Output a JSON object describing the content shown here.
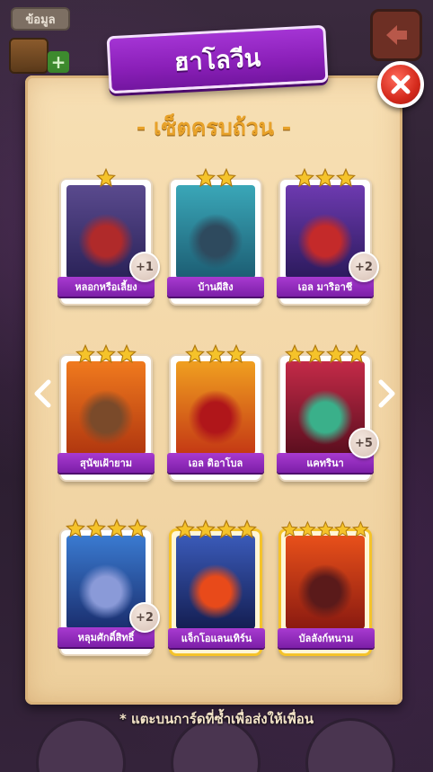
{
  "background": {
    "info_button": "ข้อมูล",
    "plus": "+"
  },
  "header": {
    "title": "ฮาโลวีน",
    "subtitle": "- เซ็ตครบถ้วน -"
  },
  "colors": {
    "ribbon": "#8a1fb8",
    "subtitle": "#e8a22a",
    "close": "#d42a1c",
    "star": "#f5c32a",
    "label": "#7c1fa8"
  },
  "cards": [
    {
      "name": "หลอกหรือเลี้ยง",
      "stars": 1,
      "badge": "+1",
      "gold": false,
      "art": "vampire"
    },
    {
      "name": "บ้านผีสิง",
      "stars": 2,
      "badge": "",
      "gold": false,
      "art": "haunted-house"
    },
    {
      "name": "เอล มาริอาชี",
      "stars": 3,
      "badge": "+2",
      "gold": false,
      "art": "skeleton-mariachi"
    },
    {
      "name": "สุนัขเฝ้ายาม",
      "stars": 3,
      "badge": "",
      "gold": false,
      "art": "guard-dog"
    },
    {
      "name": "เอล ดิอาโบล",
      "stars": 3,
      "badge": "",
      "gold": false,
      "art": "devil"
    },
    {
      "name": "แคทรินา",
      "stars": 4,
      "badge": "+5",
      "gold": false,
      "art": "catrina"
    },
    {
      "name": "หลุมศักดิ์สิทธิ์",
      "stars": 4,
      "badge": "+2",
      "gold": false,
      "art": "sugar-skull-tomb"
    },
    {
      "name": "แจ็กโอแลนเทิร์น",
      "stars": 4,
      "badge": "",
      "gold": true,
      "art": "jack-o-lantern"
    },
    {
      "name": "บัลลังก์หนาม",
      "stars": 5,
      "badge": "",
      "gold": true,
      "art": "thorn-throne"
    }
  ],
  "footer": {
    "note": "* แตะบนการ์ดที่ซ้ำเพื่อส่งให้เพื่อน"
  }
}
